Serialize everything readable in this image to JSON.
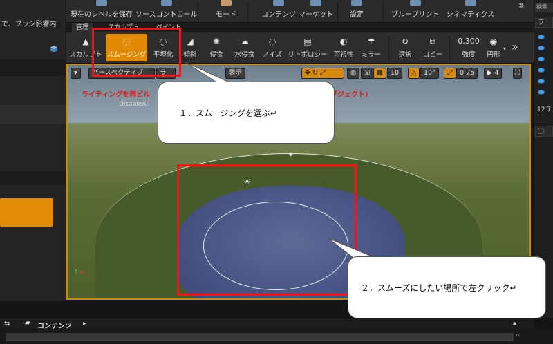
{
  "left_panel": {
    "hint_text": "で、ブラシ影響内"
  },
  "top_toolbar": {
    "items": [
      {
        "label": "現在のレベルを保存"
      },
      {
        "label": "ソースコントロール"
      },
      {
        "label": "モード"
      },
      {
        "label": "コンテンツ"
      },
      {
        "label": "マーケット"
      },
      {
        "label": "設定"
      },
      {
        "label": "ブループリント"
      },
      {
        "label": "シネマティクス"
      }
    ],
    "more_glyph": "»"
  },
  "mode_tabs": [
    {
      "label": "管理"
    },
    {
      "label": "スカルプト"
    },
    {
      "label": "ペイント"
    }
  ],
  "tools": [
    {
      "label": "スカルプト",
      "icon": "▲"
    },
    {
      "label": "スムージング",
      "icon": "◌"
    },
    {
      "label": "平坦化",
      "icon": "◌"
    },
    {
      "label": "傾斜",
      "icon": "◢"
    },
    {
      "label": "侵食",
      "icon": "✺"
    },
    {
      "label": "水侵食",
      "icon": "☁"
    },
    {
      "label": "ノイズ",
      "icon": "◌"
    },
    {
      "label": "リトポロジー",
      "icon": "▤"
    },
    {
      "label": "可視性",
      "icon": "◐"
    },
    {
      "label": "ミラー",
      "icon": "☂"
    },
    {
      "label": "選択",
      "icon": "↻"
    },
    {
      "label": "コピー",
      "icon": "⧉"
    }
  ],
  "tool_settings": {
    "strength_value": "0.300",
    "strength_label": "強度",
    "shape_label": "円形",
    "more_glyph": "»"
  },
  "viewport": {
    "menu_glyph": "▾",
    "perspective_label": "パースペクティブ",
    "lit_label": "ラ",
    "show_label": "表示",
    "grid_value": "10",
    "rotate_value": "10°",
    "scale_value": "0.25",
    "camera_speed": "4",
    "warning_left": "ライティングを再ビル",
    "warning_right": "ブジェクト)",
    "disable_text": "DisableAll"
  },
  "right_panel": {
    "search_placeholder": "検索",
    "label_ra": "ラ",
    "value_12": "12 7"
  },
  "callouts": {
    "step1": "１．スムージングを選ぶ↵",
    "step2": "２．スムーズにしたい場所で左クリック↵"
  },
  "bottom": {
    "content_label": "コンテンツ",
    "arrows": "⇆",
    "chevron": "▸"
  },
  "colors": {
    "accent": "#e08a06",
    "highlight_red": "#ff1010"
  }
}
